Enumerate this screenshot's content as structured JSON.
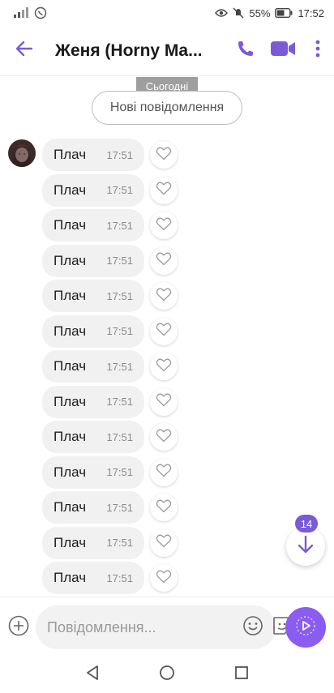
{
  "status_bar": {
    "battery": "55%",
    "time": "17:52",
    "icons": [
      "signal-icon",
      "viber-icon",
      "eye-icon",
      "mute-icon",
      "battery-icon"
    ]
  },
  "header": {
    "title": "Женя (Horny Ma...",
    "icons": [
      "back-arrow-icon",
      "phone-icon",
      "video-icon",
      "more-vert-icon"
    ],
    "accent": "#7b5ad6"
  },
  "date_chip": "Сьогодні",
  "new_messages_label": "Нові повідомлення",
  "messages": [
    {
      "text": "Плач",
      "time": "17:51"
    },
    {
      "text": "Плач",
      "time": "17:51"
    },
    {
      "text": "Плач",
      "time": "17:51"
    },
    {
      "text": "Плач",
      "time": "17:51"
    },
    {
      "text": "Плач",
      "time": "17:51"
    },
    {
      "text": "Плач",
      "time": "17:51"
    },
    {
      "text": "Плач",
      "time": "17:51"
    },
    {
      "text": "Плач",
      "time": "17:51"
    },
    {
      "text": "Плач",
      "time": "17:51"
    },
    {
      "text": "Плач",
      "time": "17:51"
    },
    {
      "text": "Плач",
      "time": "17:51"
    },
    {
      "text": "Плач",
      "time": "17:51"
    },
    {
      "text": "Плач",
      "time": "17:51"
    }
  ],
  "scroll_fab": {
    "unread_count": "14",
    "icon": "arrow-down-icon"
  },
  "composer": {
    "placeholder": "Повідомлення...",
    "icons": [
      "add-icon",
      "emoji-icon",
      "sticker-icon",
      "send-icon"
    ],
    "send_color": "#8a5cf0"
  },
  "nav_bar": {
    "icons": [
      "back-triangle-icon",
      "home-circle-icon",
      "recents-square-icon"
    ]
  }
}
